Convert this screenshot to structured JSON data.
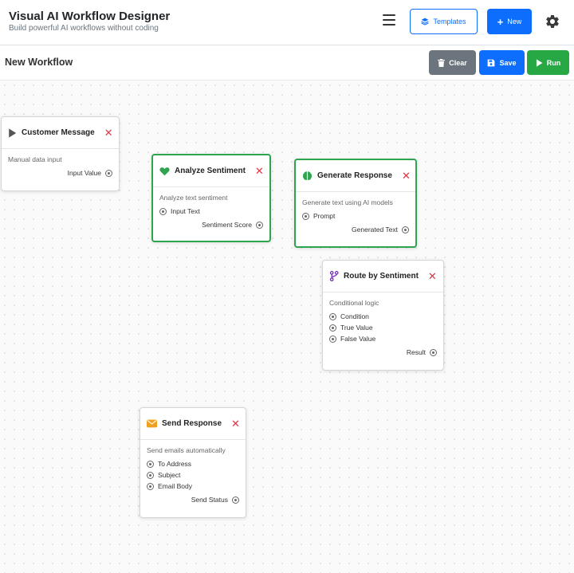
{
  "header": {
    "title": "Visual AI Workflow Designer",
    "subtitle": "Build powerful AI workflows without coding",
    "templates_label": "Templates",
    "new_label": "New"
  },
  "toolbar": {
    "workflow_title": "New Workflow",
    "clear_label": "Clear",
    "save_label": "Save",
    "run_label": "Run"
  },
  "nodes": {
    "customer_message": {
      "title": "Customer Message",
      "icon": "play-icon",
      "description": "Manual data input",
      "inputs": [],
      "outputs": [
        "Input Value"
      ]
    },
    "analyze_sentiment": {
      "title": "Analyze Sentiment",
      "icon": "heart-icon",
      "description": "Analyze text sentiment",
      "inputs": [
        "Input Text"
      ],
      "outputs": [
        "Sentiment Score"
      ]
    },
    "generate_response": {
      "title": "Generate Response",
      "icon": "brain-icon",
      "description": "Generate text using AI models",
      "inputs": [
        "Prompt"
      ],
      "outputs": [
        "Generated Text"
      ]
    },
    "route_by_sentiment": {
      "title": "Route by Sentiment",
      "icon": "branch-icon",
      "description": "Conditional logic",
      "inputs": [
        "Condition",
        "True Value",
        "False Value"
      ],
      "outputs": [
        "Result"
      ]
    },
    "send_response": {
      "title": "Send Response",
      "icon": "envelope-icon",
      "description": "Send emails automatically",
      "inputs": [
        "To Address",
        "Subject",
        "Email Body"
      ],
      "outputs": [
        "Send Status"
      ]
    }
  },
  "colors": {
    "primary": "#0d6efd",
    "success": "#28a745",
    "secondary": "#6c757d",
    "danger": "#dc3545",
    "heart": "#2ea44f",
    "brain": "#2ea44f",
    "branch": "#7b2fbe",
    "envelope": "#f0a020"
  }
}
